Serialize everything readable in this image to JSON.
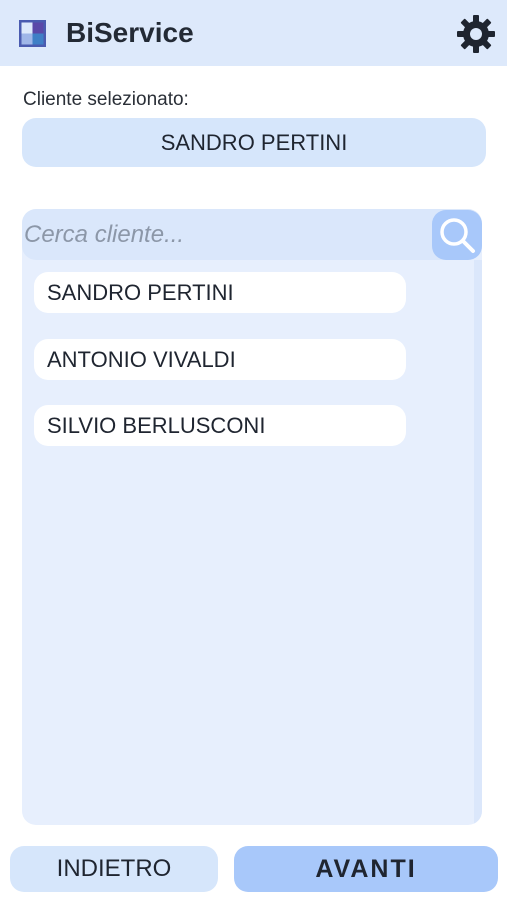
{
  "header": {
    "app_title": "BiService",
    "logo_icon": "app-logo-icon",
    "settings_icon": "gear-icon"
  },
  "selection": {
    "label": "Cliente selezionato:",
    "value": "SANDRO PERTINI"
  },
  "search": {
    "placeholder": "Cerca cliente...",
    "value": "",
    "icon": "search-icon"
  },
  "clients": [
    {
      "name": "SANDRO PERTINI"
    },
    {
      "name": "ANTONIO VIVALDI"
    },
    {
      "name": "SILVIO BERLUSCONI"
    }
  ],
  "footer": {
    "back_label": "INDIETRO",
    "next_label": "AVANTI"
  },
  "colors": {
    "header_bg": "#dde9fb",
    "panel_bg": "#e7effd",
    "accent": "#a8c8fa",
    "button_light": "#d6e6fb",
    "text": "#1f2530"
  }
}
